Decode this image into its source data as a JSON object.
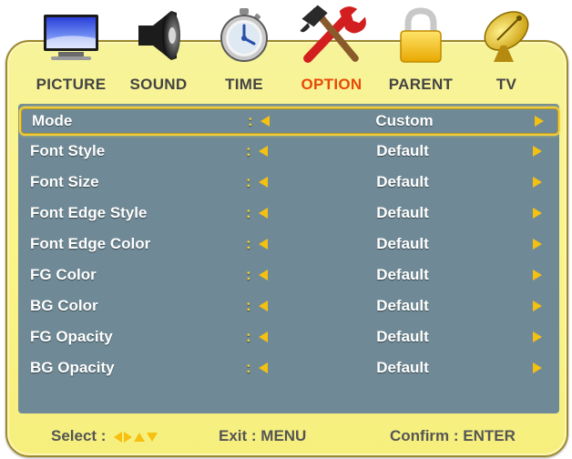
{
  "tabs": [
    {
      "label": "PICTURE",
      "icon": "monitor-icon",
      "active": false
    },
    {
      "label": "SOUND",
      "icon": "speaker-icon",
      "active": false
    },
    {
      "label": "TIME",
      "icon": "stopwatch-icon",
      "active": false
    },
    {
      "label": "OPTION",
      "icon": "tools-icon",
      "active": true
    },
    {
      "label": "PARENT",
      "icon": "lock-icon",
      "active": false
    },
    {
      "label": "TV",
      "icon": "satellite-dish-icon",
      "active": false
    }
  ],
  "menu": {
    "colon": ":",
    "rows": [
      {
        "name": "Mode",
        "value": "Custom",
        "selected": true
      },
      {
        "name": "Font Style",
        "value": "Default"
      },
      {
        "name": "Font Size",
        "value": "Default"
      },
      {
        "name": "Font Edge Style",
        "value": "Default"
      },
      {
        "name": "Font Edge Color",
        "value": "Default"
      },
      {
        "name": "FG Color",
        "value": "Default"
      },
      {
        "name": "BG Color",
        "value": "Default"
      },
      {
        "name": "FG Opacity",
        "value": "Default"
      },
      {
        "name": "BG Opacity",
        "value": "Default"
      }
    ]
  },
  "footer": {
    "select_label": "Select :",
    "exit_label": "Exit : MENU",
    "confirm_label": "Confirm : ENTER"
  },
  "colors": {
    "panel": "#f8f28c",
    "list_bg": "#6f8a96",
    "active_tab": "#e84a08",
    "arrow": "#f5c010",
    "highlight_border": "#f2cd3a"
  }
}
